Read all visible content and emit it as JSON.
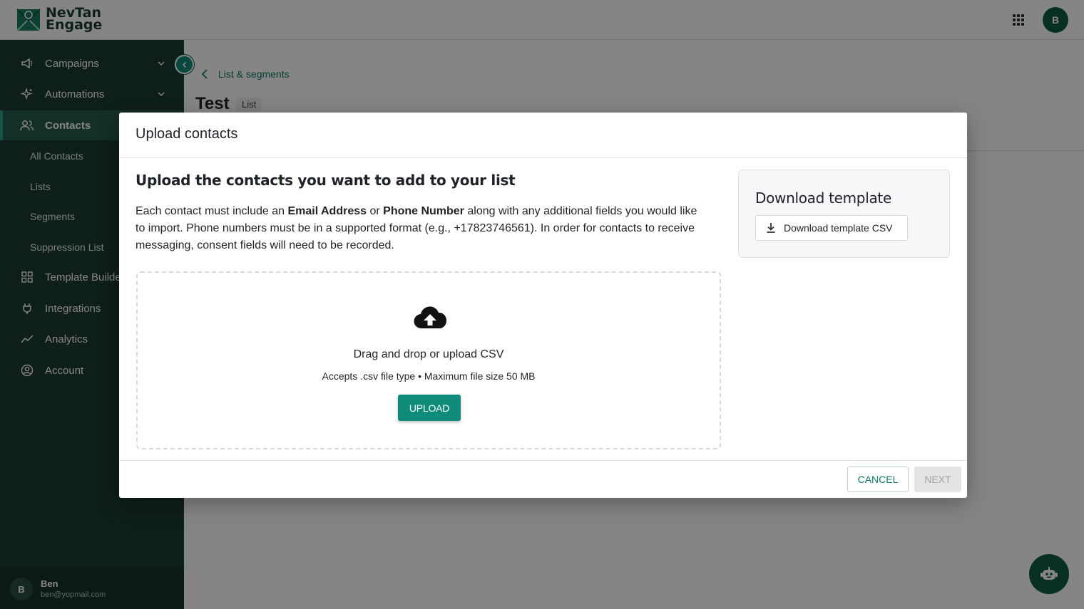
{
  "app": {
    "logo_line1": "NevTan",
    "logo_line2": "Engage",
    "user_initial": "B"
  },
  "sidebar": {
    "items": [
      {
        "label": "Campaigns",
        "icon": "megaphone-icon",
        "expandable": true
      },
      {
        "label": "Automations",
        "icon": "sparkle-icon",
        "expandable": true
      },
      {
        "label": "Contacts",
        "icon": "people-icon",
        "active": true
      },
      {
        "label": "Template Builder",
        "icon": "grid-icon"
      },
      {
        "label": "Integrations",
        "icon": "plug-icon"
      },
      {
        "label": "Analytics",
        "icon": "trend-line-icon"
      },
      {
        "label": "Account",
        "icon": "user-circle-icon"
      }
    ],
    "contacts_sub": [
      "All Contacts",
      "Lists",
      "Segments",
      "Suppression List"
    ],
    "user": {
      "initial": "B",
      "name": "Ben",
      "email": "ben@yopmail.com"
    }
  },
  "main": {
    "breadcrumb": "List & segments",
    "title": "Test",
    "badge": "List"
  },
  "modal": {
    "title": "Upload contacts",
    "section_title": "Upload the contacts you want to add to your list",
    "desc_part1": "Each contact must include an ",
    "desc_bold1": "Email Address",
    "desc_part2": " or ",
    "desc_bold2": "Phone Number",
    "desc_part3": " along with any additional fields you would like to import. Phone numbers must be in a supported format (e.g., +17823746561). In order for contacts to receive messaging, consent fields will need to be recorded.",
    "dropzone": {
      "title": "Drag and drop or upload CSV",
      "subtitle": "Accepts .csv file type • Maximum file size 50 MB",
      "upload_label": "UPLOAD"
    },
    "template": {
      "title": "Download template",
      "button_label": "Download template CSV"
    },
    "cancel_label": "CANCEL",
    "next_label": "NEXT"
  },
  "colors": {
    "sidebar_bg": "#1c3b33",
    "accent": "#0f8b79",
    "brand_dark": "#0f5a46"
  }
}
